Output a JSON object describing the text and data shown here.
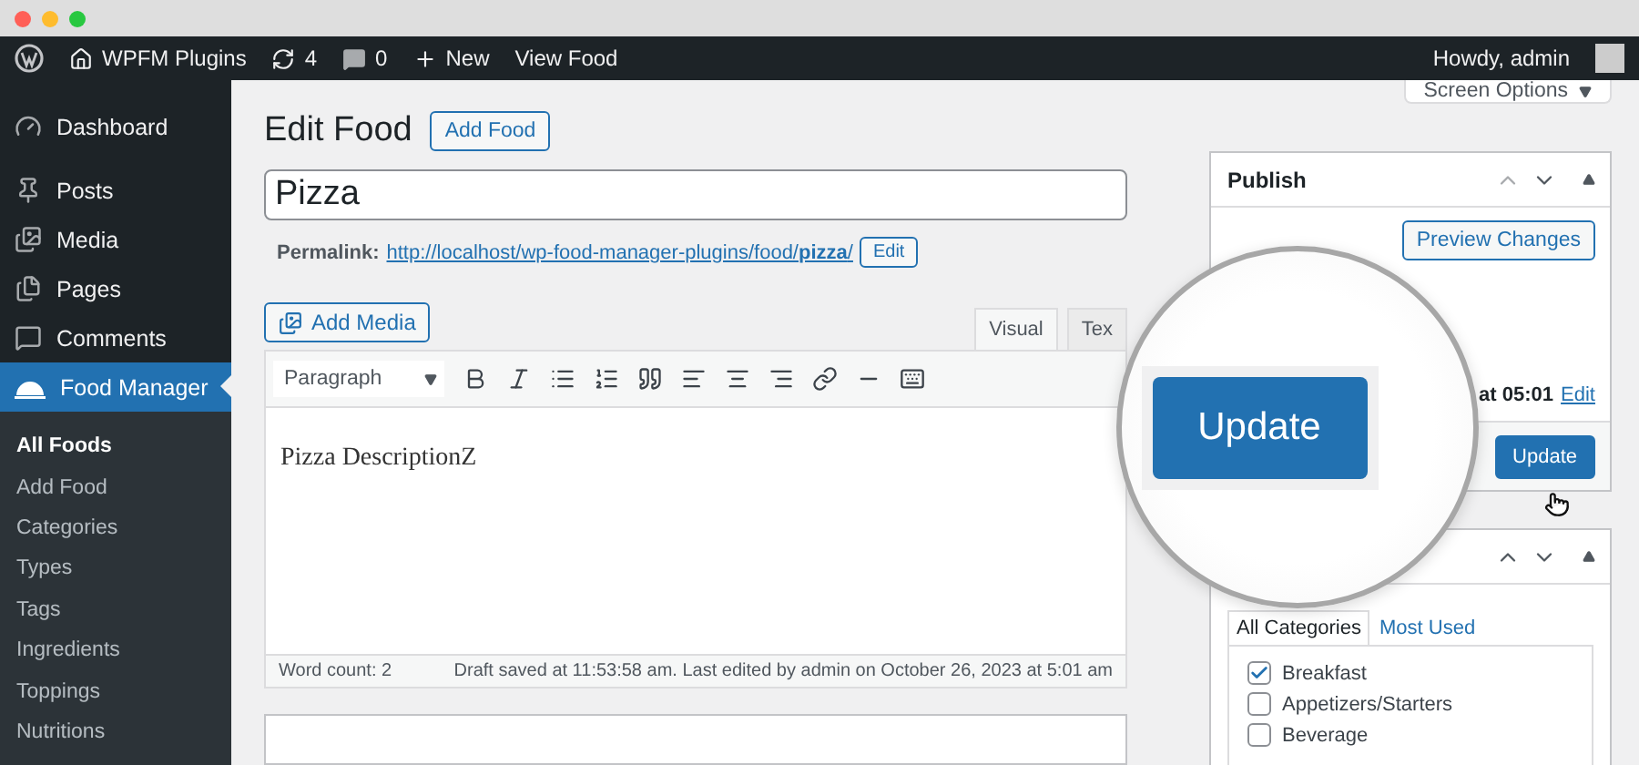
{
  "admin_bar": {
    "site": "WPFM Plugins",
    "updates": "4",
    "comments": "0",
    "new": "New",
    "view": "View Food",
    "greeting": "Howdy, admin"
  },
  "sidebar": {
    "items": [
      {
        "label": "Dashboard",
        "selected": false
      },
      {
        "label": "Posts",
        "selected": false
      },
      {
        "label": "Media",
        "selected": false
      },
      {
        "label": "Pages",
        "selected": false
      },
      {
        "label": "Comments",
        "selected": false
      },
      {
        "label": "Food Manager",
        "selected": true
      }
    ],
    "submenu": [
      {
        "label": "All Foods",
        "selected": true
      },
      {
        "label": "Add Food",
        "selected": false
      },
      {
        "label": "Categories",
        "selected": false
      },
      {
        "label": "Types",
        "selected": false
      },
      {
        "label": "Tags",
        "selected": false
      },
      {
        "label": "Ingredients",
        "selected": false
      },
      {
        "label": "Toppings",
        "selected": false
      },
      {
        "label": "Nutritions",
        "selected": false
      }
    ]
  },
  "screen_options": "Screen Options",
  "page": {
    "title": "Edit Food",
    "add_button": "Add Food"
  },
  "post_title": "Pizza",
  "permalink": {
    "label": "Permalink:",
    "url": "http://localhost/wp-food-manager-plugins/food/**pizza**/",
    "edit": "Edit"
  },
  "editor": {
    "add_media": "Add Media",
    "tabs": [
      {
        "label": "Visual",
        "selected": true
      },
      {
        "label": "Tex",
        "selected": false
      }
    ],
    "format": "Paragraph",
    "content": "Pizza DescriptionZ",
    "word_count": "Word count: 2",
    "draft_status": "Draft saved at 11:53:58 am. Last edited by admin on October 26, 2023 at 5:01 am"
  },
  "publish": {
    "title": "Publish",
    "preview": "Preview Changes",
    "schedule": "at 05:01",
    "edit": "Edit",
    "update": "Update"
  },
  "magnifier": {
    "button": "Update"
  },
  "categories": {
    "tabs": [
      {
        "label": "All Categories",
        "selected": true
      },
      {
        "label": "Most Used",
        "selected": false
      }
    ],
    "items": [
      {
        "label": "Breakfast",
        "checked": true
      },
      {
        "label": "Appetizers/Starters",
        "checked": false
      },
      {
        "label": "Beverage",
        "checked": false
      }
    ]
  }
}
